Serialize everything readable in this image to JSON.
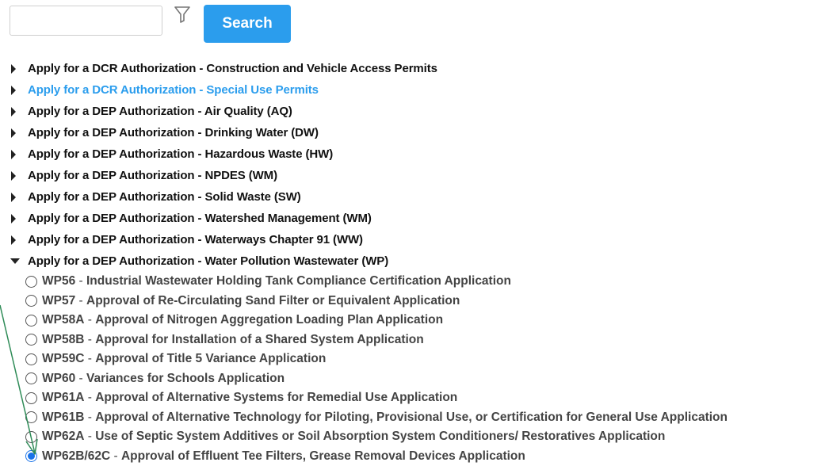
{
  "search": {
    "value": "",
    "placeholder": "",
    "button_label": "Search"
  },
  "categories": [
    {
      "label": "Apply for a DCR Authorization - Construction and Vehicle Access Permits"
    },
    {
      "label": "Apply for a DCR Authorization - Special Use Permits"
    },
    {
      "label": "Apply for a DEP Authorization - Air Quality (AQ)"
    },
    {
      "label": "Apply for a DEP Authorization - Drinking Water (DW)"
    },
    {
      "label": "Apply for a DEP Authorization - Hazardous Waste (HW)"
    },
    {
      "label": "Apply for a DEP Authorization - NPDES (WM)"
    },
    {
      "label": "Apply for a DEP Authorization - Solid Waste (SW)"
    },
    {
      "label": "Apply for a DEP Authorization - Watershed Management (WM)"
    },
    {
      "label": "Apply for a DEP Authorization - Waterways Chapter 91 (WW)"
    },
    {
      "label": "Apply for a DEP Authorization - Water Pollution Wastewater (WP)"
    }
  ],
  "hovered_category_index": 1,
  "expanded_category_index": 9,
  "sub_items": [
    {
      "code": "WP56",
      "desc": "Industrial Wastewater Holding Tank Compliance Certification Application"
    },
    {
      "code": "WP57",
      "desc": "Approval of Re-Circulating Sand Filter or Equivalent Application"
    },
    {
      "code": "WP58A",
      "desc": "Approval of Nitrogen Aggregation Loading Plan Application"
    },
    {
      "code": "WP58B",
      "desc": "Approval for Installation of a Shared System Application"
    },
    {
      "code": "WP59C",
      "desc": "Approval of Title 5 Variance Application"
    },
    {
      "code": "WP60",
      "desc": "Variances for Schools Application"
    },
    {
      "code": "WP61A",
      "desc": "Approval of Alternative Systems for Remedial Use Application"
    },
    {
      "code": "WP61B",
      "desc": "Approval of Alternative Technology for Piloting, Provisional Use, or Certification for General Use Application"
    },
    {
      "code": "WP62A",
      "desc": "Use of Septic System Additives or Soil Absorption System Conditioners/ Restoratives Application"
    },
    {
      "code": "WP62B/62C",
      "desc": "Approval of Effluent Tee Filters, Grease Removal Devices Application"
    }
  ],
  "selected_sub_index": 9,
  "colors": {
    "accent": "#2b9ded",
    "radio_selected": "#1a73e8",
    "annotation_arrow": "#2e8b57"
  }
}
